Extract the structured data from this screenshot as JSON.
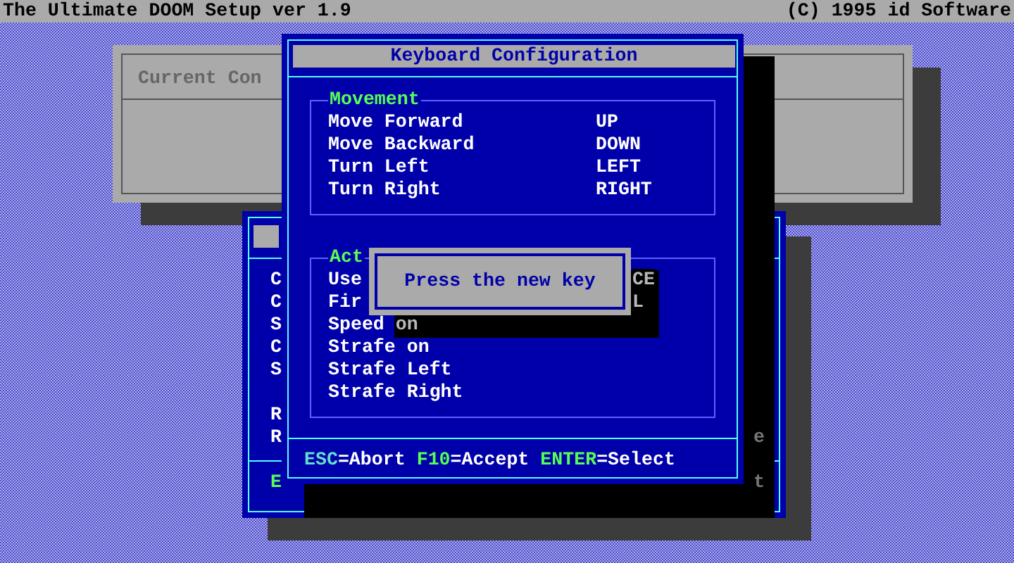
{
  "header": {
    "title": "The Ultimate DOOM Setup ver 1.9",
    "copyright": "(C) 1995 id Software"
  },
  "back_gray_window": {
    "title": "Current Con"
  },
  "back_blue_window": {
    "letter_groups": [
      [
        {
          "text": "C",
          "highlighted": false
        },
        {
          "text": "C",
          "highlighted": false
        },
        {
          "text": "S",
          "highlighted": false
        },
        {
          "text": "C",
          "highlighted": false
        },
        {
          "text": "S",
          "highlighted": false
        }
      ],
      [
        {
          "text": "R",
          "highlighted": false
        },
        {
          "text": "R",
          "highlighted": false
        }
      ],
      [
        {
          "text": "E",
          "highlighted": true
        }
      ]
    ],
    "right_letters": [
      "e",
      "t"
    ]
  },
  "keyboard_window": {
    "title": "Keyboard Configuration",
    "groups": [
      {
        "label": "Movement",
        "rows": [
          {
            "action": {
              "text": "Move Forward",
              "shadowed": false
            },
            "key": {
              "text": "UP",
              "shadowed": false
            }
          },
          {
            "action": {
              "text": "Move Backward",
              "shadowed": false
            },
            "key": {
              "text": "DOWN",
              "shadowed": false
            }
          },
          {
            "action": {
              "text": "Turn Left",
              "shadowed": false
            },
            "key": {
              "text": "LEFT",
              "shadowed": false
            }
          },
          {
            "action": {
              "text": "Turn Right",
              "shadowed": false
            },
            "key": {
              "text": "RIGHT",
              "shadowed": false
            }
          }
        ]
      },
      {
        "label": "Act",
        "rows": [
          {
            "action": {
              "text": "Use",
              "shadowed": false
            },
            "key": {
              "text": "CE",
              "shadowed": true
            }
          },
          {
            "action": {
              "text": "Fir",
              "shadowed": false
            },
            "key": {
              "text": "L",
              "shadowed": true
            }
          },
          {
            "action": {
              "text": "Speed",
              "shadowed": false
            },
            "extra": {
              "text": "on",
              "shadowed": true
            }
          },
          {
            "action": {
              "text": "Strafe on",
              "shadowed": false
            }
          },
          {
            "action": {
              "text": "Strafe Left",
              "shadowed": false
            }
          },
          {
            "action": {
              "text": "Strafe Right",
              "shadowed": false
            }
          }
        ]
      }
    ],
    "footer": [
      {
        "key": "ESC",
        "action": "=Abort"
      },
      {
        "key": "F10",
        "action": "=Accept"
      },
      {
        "key": "ENTER",
        "action": "=Select"
      }
    ]
  },
  "popup": {
    "text": "Press the new key"
  }
}
